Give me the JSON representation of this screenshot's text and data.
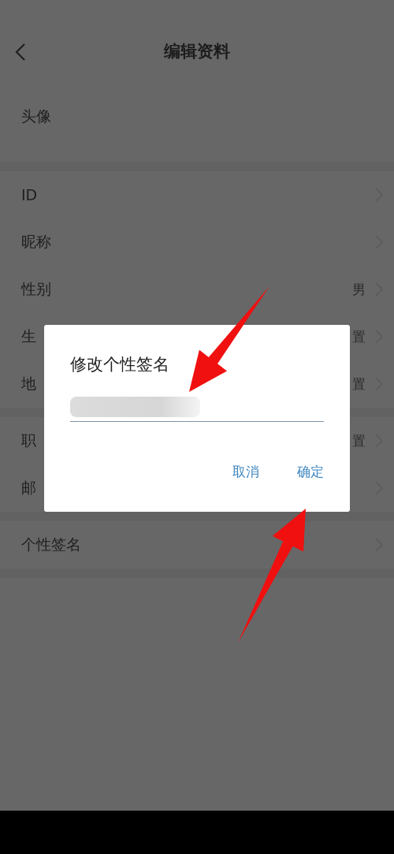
{
  "header": {
    "title": "编辑资料"
  },
  "sections": [
    {
      "rows": [
        {
          "kind": "avatar",
          "label": "头像"
        }
      ]
    },
    {
      "rows": [
        {
          "kind": "link",
          "label": "ID"
        },
        {
          "kind": "link",
          "label": "昵称"
        },
        {
          "kind": "link",
          "label": "性别",
          "value": "男"
        },
        {
          "kind": "link",
          "label": "生",
          "value": "置"
        },
        {
          "kind": "link",
          "label": "地",
          "value": "置"
        }
      ]
    },
    {
      "rows": [
        {
          "kind": "link",
          "label": "职",
          "value": "置"
        },
        {
          "kind": "link",
          "label": "邮"
        }
      ]
    },
    {
      "rows": [
        {
          "kind": "link",
          "label": "个性签名"
        }
      ]
    }
  ],
  "dialog": {
    "title": "修改个性签名",
    "buttons": [
      {
        "label": "取消"
      },
      {
        "label": "确定"
      }
    ]
  }
}
